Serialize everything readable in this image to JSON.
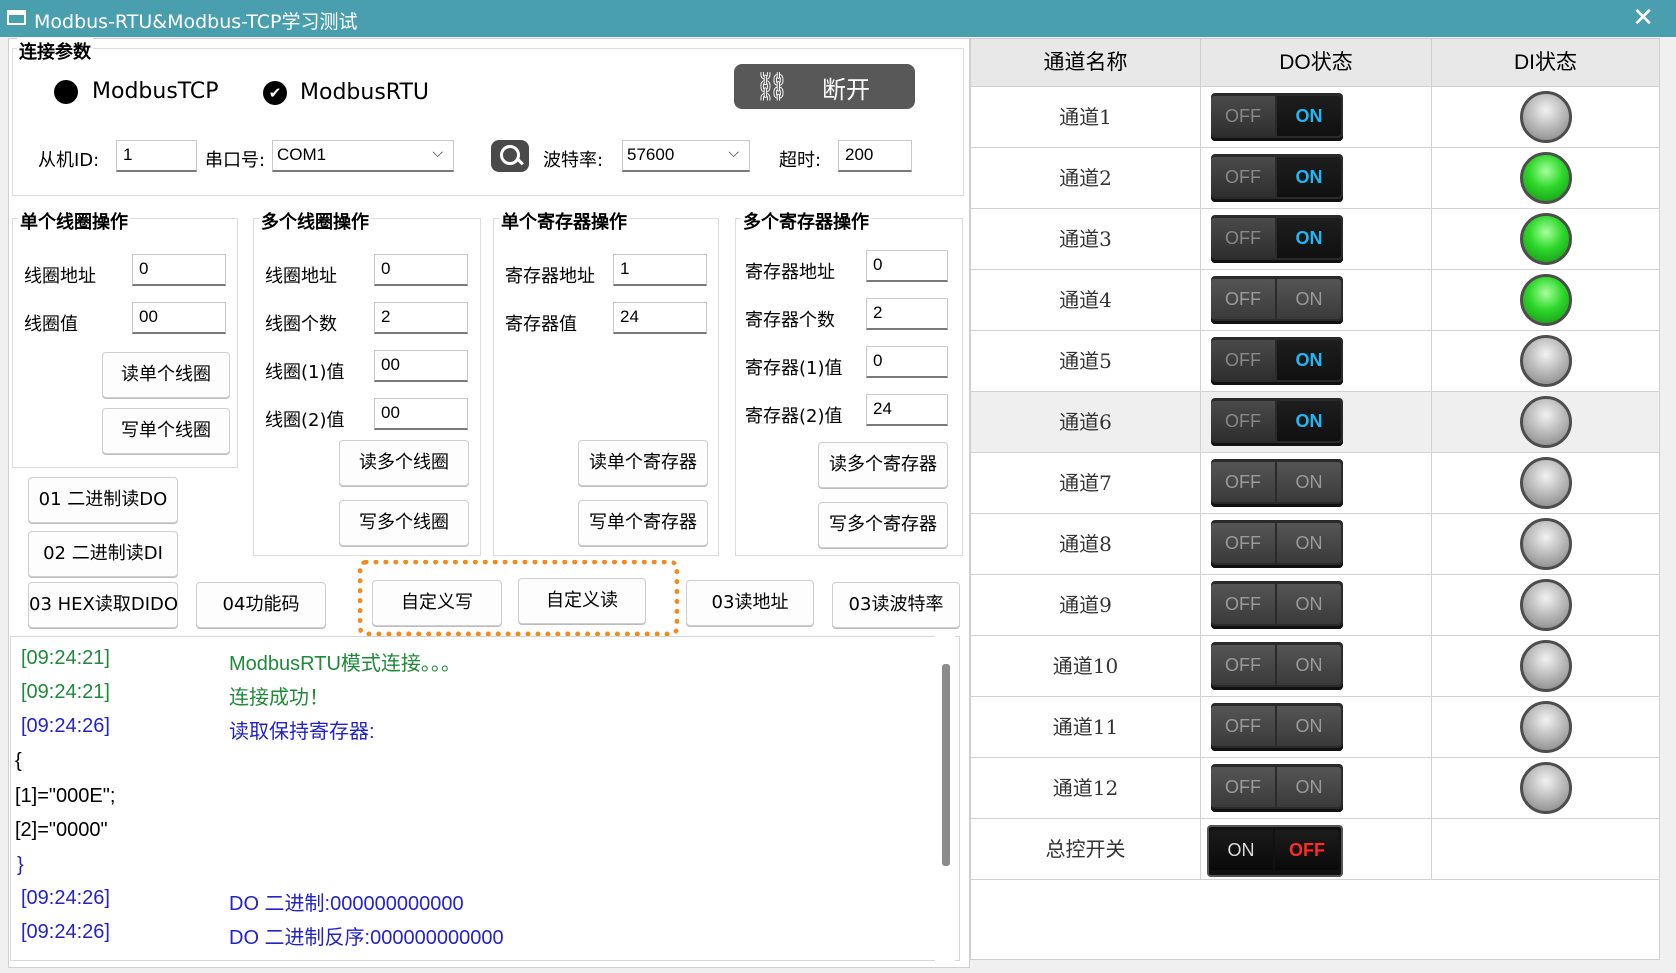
{
  "window": {
    "title": "Modbus-RTU&Modbus-TCP学习测试",
    "close_glyph": "✕"
  },
  "connection": {
    "group_label": "连接参数",
    "mode_tcp": "ModbusTCP",
    "mode_rtu": "ModbusRTU",
    "selected_mode": "ModbusRTU",
    "disconnect_label": "断开",
    "slave_id_label": "从机ID:",
    "slave_id_value": "1",
    "port_label": "串口号:",
    "port_value": "COM1",
    "baud_label": "波特率:",
    "baud_value": "57600",
    "timeout_label": "超时:",
    "timeout_value": "200"
  },
  "single_coil": {
    "group_label": "单个线圈操作",
    "addr_label": "线圈地址",
    "addr_value": "0",
    "value_label": "线圈值",
    "value_value": "00",
    "read_btn": "读单个线圈",
    "write_btn": "写单个线圈"
  },
  "multi_coil": {
    "group_label": "多个线圈操作",
    "addr_label": "线圈地址",
    "addr_value": "0",
    "count_label": "线圈个数",
    "count_value": "2",
    "v1_label": "线圈(1)值",
    "v1_value": "00",
    "v2_label": "线圈(2)值",
    "v2_value": "00",
    "read_btn": "读多个线圈",
    "write_btn": "写多个线圈"
  },
  "single_reg": {
    "group_label": "单个寄存器操作",
    "addr_label": "寄存器地址",
    "addr_value": "1",
    "value_label": "寄存器值",
    "value_value": "24",
    "read_btn": "读单个寄存器",
    "write_btn": "写单个寄存器"
  },
  "multi_reg": {
    "group_label": "多个寄存器操作",
    "addr_label": "寄存器地址",
    "addr_value": "0",
    "count_label": "寄存器个数",
    "count_value": "2",
    "v1_label": "寄存器(1)值",
    "v1_value": "0",
    "v2_label": "寄存器(2)值",
    "v2_value": "24",
    "read_btn": "读多个寄存器",
    "write_btn": "写多个寄存器"
  },
  "function_buttons": {
    "f01": "01 二进制读DO",
    "f02": "02 二进制读DI",
    "f03": "03 HEX读取DIDO",
    "f04": "04功能码",
    "custom_write": "自定义写",
    "custom_read": "自定义读",
    "read_addr": "03读地址",
    "read_baud": "03读波特率"
  },
  "log": [
    {
      "time": "[09:24:21]",
      "msg": "ModbusRTU模式连接。。。",
      "color": "#1f8a3a"
    },
    {
      "time": "[09:24:21]",
      "msg": "连接成功！",
      "color": "#1f8a3a"
    },
    {
      "time": "[09:24:26]",
      "msg": "读取保持寄存器:",
      "color": "#2323c8"
    },
    {
      "time": "",
      "msg": "{",
      "color": "#000000"
    },
    {
      "time": "",
      "msg": "[1]=\"000E\";",
      "color": "#000000"
    },
    {
      "time": "",
      "msg": "[2]=\"0000\"",
      "color": "#000000"
    },
    {
      "time": "",
      "msg": "}",
      "color": "#2323c8"
    },
    {
      "time": "[09:24:26]",
      "msg": "DO 二进制:000000000000",
      "color": "#2323c8"
    },
    {
      "time": "[09:24:26]",
      "msg": "DO 二进制反序:000000000000",
      "color": "#2323c8"
    }
  ],
  "table": {
    "headers": [
      "通道名称",
      "DO状态",
      "DI状态"
    ],
    "switch_off_label": "OFF",
    "switch_on_label": "ON",
    "rows": [
      {
        "name": "通道1",
        "do": "on",
        "di": "gray"
      },
      {
        "name": "通道2",
        "do": "on",
        "di": "green"
      },
      {
        "name": "通道3",
        "do": "on",
        "di": "green"
      },
      {
        "name": "通道4",
        "do": "off",
        "di": "green"
      },
      {
        "name": "通道5",
        "do": "on",
        "di": "gray"
      },
      {
        "name": "通道6",
        "do": "on",
        "di": "gray"
      },
      {
        "name": "通道7",
        "do": "off",
        "di": "gray"
      },
      {
        "name": "通道8",
        "do": "off",
        "di": "gray"
      },
      {
        "name": "通道9",
        "do": "off",
        "di": "gray"
      },
      {
        "name": "通道10",
        "do": "off",
        "di": "gray"
      },
      {
        "name": "通道11",
        "do": "off",
        "di": "gray"
      },
      {
        "name": "通道12",
        "do": "off",
        "di": "gray"
      }
    ],
    "master": {
      "name": "总控开关",
      "left_label": "ON",
      "right_label": "OFF"
    }
  },
  "colors": {
    "titlebar": "#4a9fae",
    "highlight": "#f28a1c",
    "switch_on": "#21b6f4",
    "master_off": "#ff2a2a"
  }
}
